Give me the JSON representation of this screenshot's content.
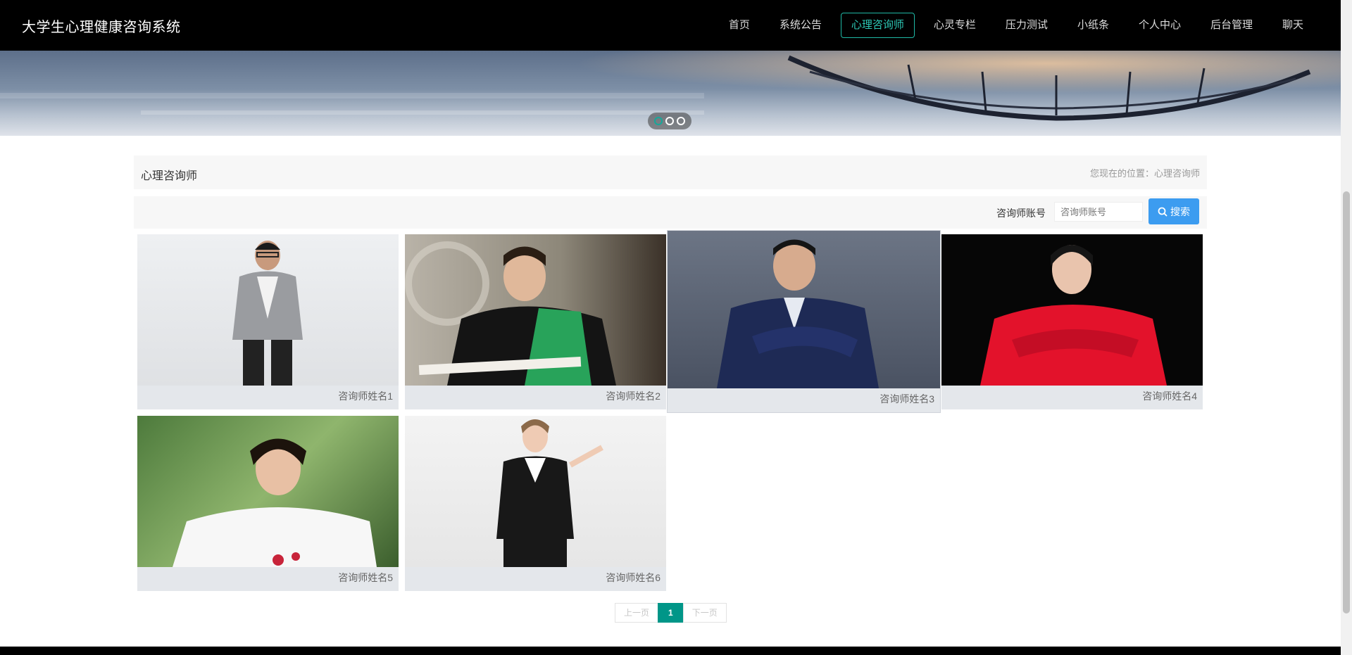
{
  "header": {
    "brand": "大学生心理健康咨询系统",
    "nav": [
      {
        "label": "首页",
        "active": false
      },
      {
        "label": "系统公告",
        "active": false
      },
      {
        "label": "心理咨询师",
        "active": true
      },
      {
        "label": "心灵专栏",
        "active": false
      },
      {
        "label": "压力测试",
        "active": false
      },
      {
        "label": "小纸条",
        "active": false
      },
      {
        "label": "个人中心",
        "active": false
      },
      {
        "label": "后台管理",
        "active": false
      },
      {
        "label": "聊天",
        "active": false
      }
    ]
  },
  "banner": {
    "slide_count": 3,
    "active_slide": 1
  },
  "titlebar": {
    "title": "心理咨询师",
    "breadcrumb": "您现在的位置：心理咨询师"
  },
  "search": {
    "label": "咨询师账号",
    "placeholder": "咨询师账号",
    "button_label": "搜索"
  },
  "counselors": [
    {
      "name": "咨询师姓名1"
    },
    {
      "name": "咨询师姓名2"
    },
    {
      "name": "咨询师姓名3"
    },
    {
      "name": "咨询师姓名4"
    },
    {
      "name": "咨询师姓名5"
    },
    {
      "name": "咨询师姓名6"
    }
  ],
  "pagination": {
    "prev": "上一页",
    "current": "1",
    "next": "下一页"
  }
}
